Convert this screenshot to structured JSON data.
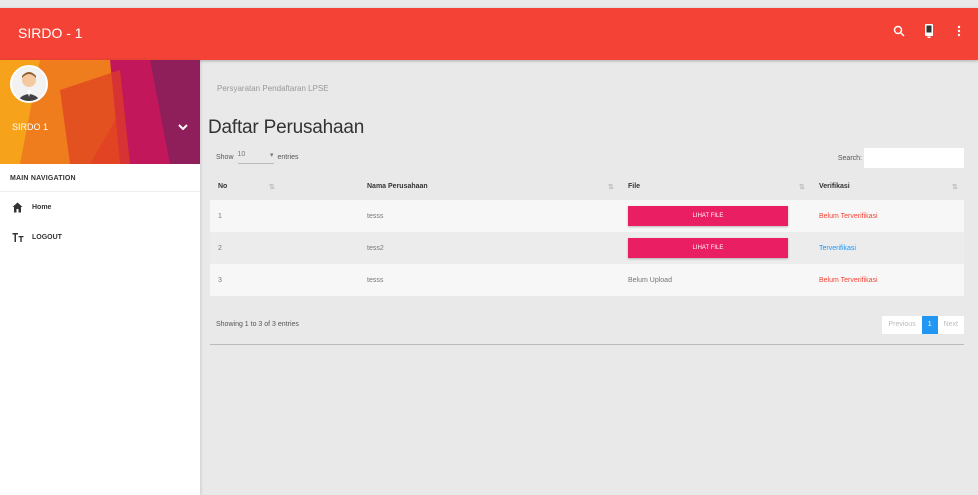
{
  "app": {
    "title": "SIRDO - 1"
  },
  "topbar": {
    "icons": [
      "search-icon",
      "notification-icon",
      "more-vert-icon"
    ]
  },
  "sidebar": {
    "user_name": "SIRDO 1",
    "nav_header": "MAIN NAVIGATION",
    "items": [
      {
        "label": "Home",
        "icon": "home-icon"
      },
      {
        "label": "LOGOUT",
        "icon": "text-format-icon"
      }
    ]
  },
  "main": {
    "breadcrumb": "Persyaratan Pendaftaran LPSE",
    "title": "Daftar Perusahaan",
    "length_show": "Show",
    "length_value": "10",
    "length_entries": "entries",
    "search_label": "Search:",
    "columns": [
      "No",
      "Nama Perusahaan",
      "File",
      "Verifikasi"
    ],
    "rows": [
      {
        "no": "1",
        "nama": "tesss",
        "file": "LIHAT FILE",
        "verifikasi": "Belum Terverifikasi",
        "status": "red"
      },
      {
        "no": "2",
        "nama": "tess2",
        "file": "LIHAT FILE",
        "verifikasi": "Terverifikasi",
        "status": "blue"
      },
      {
        "no": "3",
        "nama": "tesss",
        "file": "Belum Upload",
        "verifikasi": "Belum Terverifikasi",
        "status": "red"
      }
    ],
    "info": "Showing 1 to 3 of 3 entries",
    "pagination": {
      "previous": "Previous",
      "current": "1",
      "next": "Next"
    }
  },
  "colors": {
    "topbar": "#f44336",
    "button": "#e91e63",
    "link_red": "#f44336",
    "link_blue": "#2196f3"
  }
}
